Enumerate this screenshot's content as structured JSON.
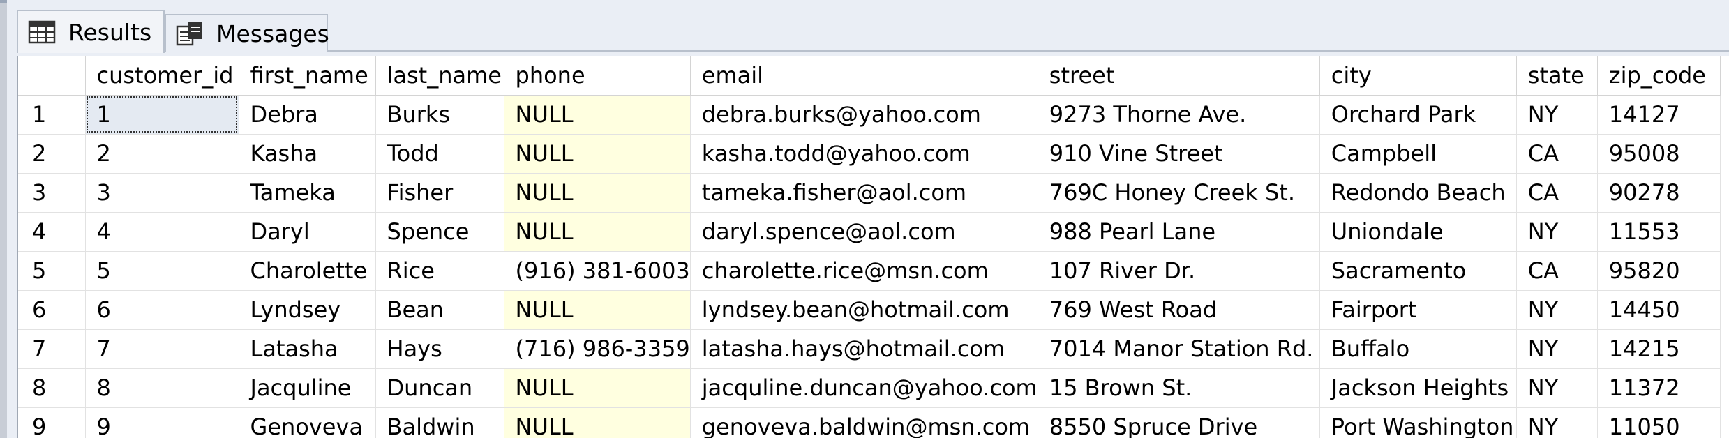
{
  "tabs": [
    {
      "label": "Results",
      "icon": "grid-icon",
      "active": true
    },
    {
      "label": "Messages",
      "icon": "messages-icon",
      "active": false
    }
  ],
  "grid": {
    "columns": [
      "",
      "customer_id",
      "first_name",
      "last_name",
      "phone",
      "email",
      "street",
      "city",
      "state",
      "zip_code"
    ],
    "rows": [
      [
        "1",
        "1",
        "Debra",
        "Burks",
        "NULL",
        "debra.burks@yahoo.com",
        "9273 Thorne Ave.",
        "Orchard Park",
        "NY",
        "14127"
      ],
      [
        "2",
        "2",
        "Kasha",
        "Todd",
        "NULL",
        "kasha.todd@yahoo.com",
        "910 Vine Street",
        "Campbell",
        "CA",
        "95008"
      ],
      [
        "3",
        "3",
        "Tameka",
        "Fisher",
        "NULL",
        "tameka.fisher@aol.com",
        "769C Honey Creek St.",
        "Redondo Beach",
        "CA",
        "90278"
      ],
      [
        "4",
        "4",
        "Daryl",
        "Spence",
        "NULL",
        "daryl.spence@aol.com",
        "988 Pearl Lane",
        "Uniondale",
        "NY",
        "11553"
      ],
      [
        "5",
        "5",
        "Charolette",
        "Rice",
        "(916) 381-6003",
        "charolette.rice@msn.com",
        "107 River Dr.",
        "Sacramento",
        "CA",
        "95820"
      ],
      [
        "6",
        "6",
        "Lyndsey",
        "Bean",
        "NULL",
        "lyndsey.bean@hotmail.com",
        "769 West Road",
        "Fairport",
        "NY",
        "14450"
      ],
      [
        "7",
        "7",
        "Latasha",
        "Hays",
        "(716) 986-3359",
        "latasha.hays@hotmail.com",
        "7014 Manor Station Rd.",
        "Buffalo",
        "NY",
        "14215"
      ],
      [
        "8",
        "8",
        "Jacquline",
        "Duncan",
        "NULL",
        "jacquline.duncan@yahoo.com",
        "15 Brown St.",
        "Jackson Heights",
        "NY",
        "11372"
      ],
      [
        "9",
        "9",
        "Genoveva",
        "Baldwin",
        "NULL",
        "genoveva.baldwin@msn.com",
        "8550 Spruce Drive",
        "Port Washington",
        "NY",
        "11050"
      ]
    ],
    "null_marker": "NULL",
    "null_color": "#ffffe0",
    "selected_cell_color": "#e4eaf2"
  }
}
